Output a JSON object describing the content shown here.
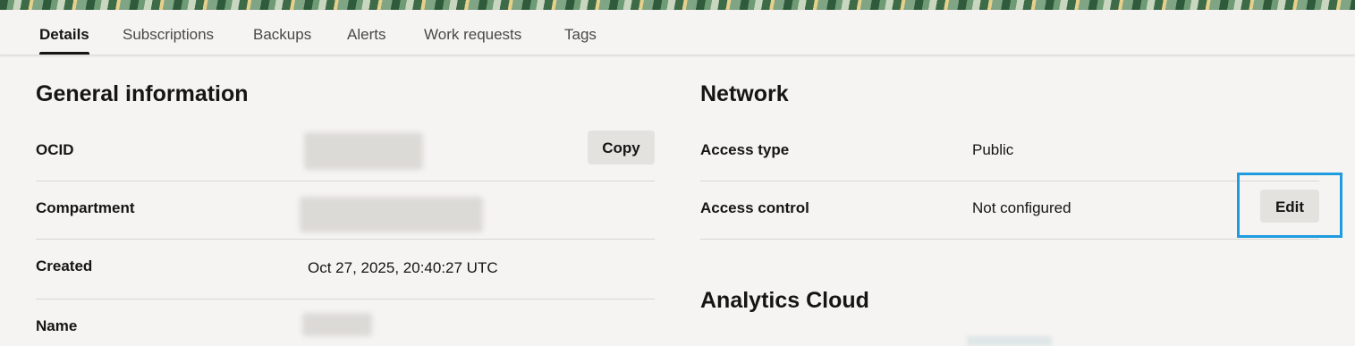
{
  "tabs": [
    {
      "label": "Details",
      "active": true
    },
    {
      "label": "Subscriptions",
      "active": false
    },
    {
      "label": "Backups",
      "active": false
    },
    {
      "label": "Alerts",
      "active": false
    },
    {
      "label": "Work requests",
      "active": false
    },
    {
      "label": "Tags",
      "active": false
    }
  ],
  "general": {
    "title": "General information",
    "ocid_label": "OCID",
    "copy_label": "Copy",
    "compartment_label": "Compartment",
    "created_label": "Created",
    "created_value": "Oct 27, 2025, 20:40:27 UTC",
    "name_label": "Name"
  },
  "network": {
    "title": "Network",
    "access_type_label": "Access type",
    "access_type_value": "Public",
    "access_control_label": "Access control",
    "access_control_value": "Not configured",
    "edit_label": "Edit"
  },
  "analytics": {
    "title": "Analytics Cloud"
  },
  "colors": {
    "background": "#f5f4f2",
    "highlight": "#1f9be0",
    "button": "#e4e2de"
  }
}
